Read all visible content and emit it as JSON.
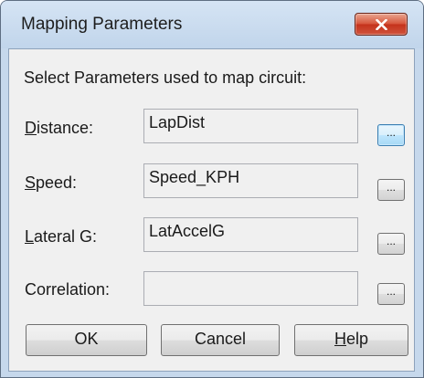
{
  "window": {
    "title": "Mapping Parameters"
  },
  "dialog": {
    "instruction": "Select Parameters used to map circuit:",
    "fields": [
      {
        "accel": "D",
        "label_rest": "istance:",
        "value": "LapDist"
      },
      {
        "accel": "S",
        "label_rest": "peed:",
        "value": "Speed_KPH"
      },
      {
        "accel": "L",
        "label_rest": "ateral G:",
        "value": "LatAccelG"
      },
      {
        "label": "Correlation:",
        "value": ""
      }
    ],
    "browse_label": "...",
    "buttons": {
      "ok": "OK",
      "cancel": "Cancel",
      "help_accel": "H",
      "help_rest": "elp"
    }
  },
  "colors": {
    "close_button": "#c4331c",
    "focused_button": "#3c7fb1",
    "dialog_background": "#f0f0f0"
  }
}
